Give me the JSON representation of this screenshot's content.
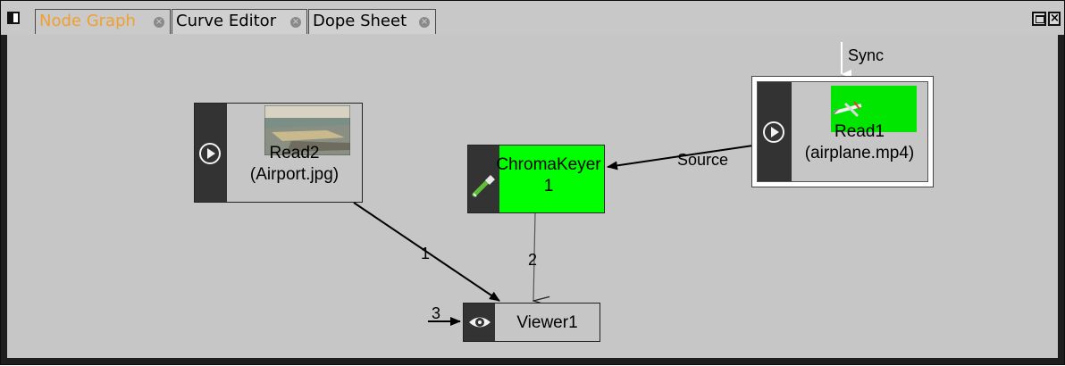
{
  "tabs": [
    {
      "label": "Node Graph",
      "active": true
    },
    {
      "label": "Curve Editor",
      "active": false
    },
    {
      "label": "Dope Sheet",
      "active": false
    }
  ],
  "tab_close_glyph": "×",
  "window_close_glyph": "×",
  "nodes": {
    "read2": {
      "line1": "Read2",
      "line2": "(Airport.jpg)"
    },
    "chromakeyer": {
      "line1": "ChromaKeyer",
      "line2": "1"
    },
    "read1": {
      "line1": "Read1",
      "line2": "(airplane.mp4)"
    },
    "viewer": {
      "label": "Viewer1"
    }
  },
  "edge_labels": {
    "sync": "Sync",
    "source": "Source",
    "viewer_input_1": "1",
    "viewer_input_2": "2",
    "viewer_input_3": "3"
  },
  "colors": {
    "active_tab": "#f0a030",
    "chromakeyer_fill": "#00ff00",
    "canvas_bg": "#c6c6c6",
    "node_side": "#333333"
  }
}
